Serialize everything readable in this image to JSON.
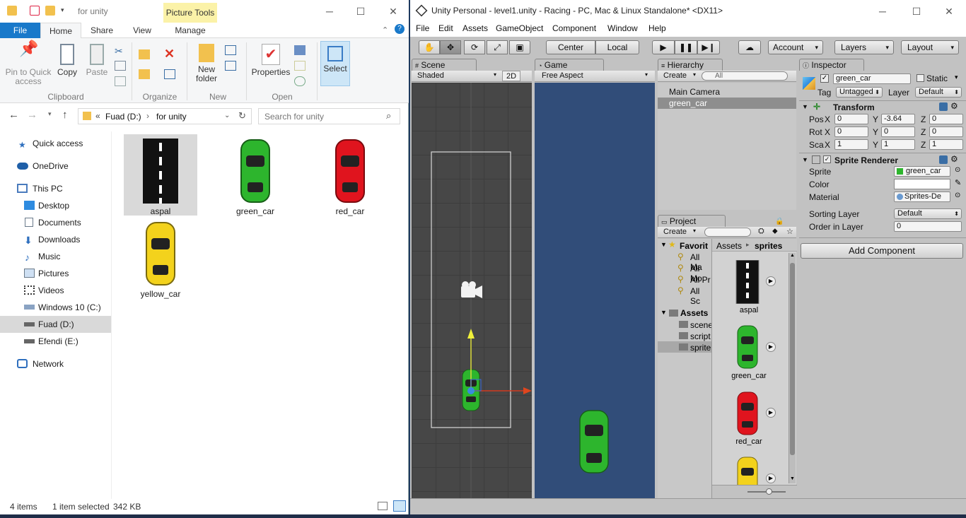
{
  "explorer": {
    "title": "for unity",
    "picture_tools": "Picture Tools",
    "tabs": [
      "File",
      "Home",
      "Share",
      "View",
      "Manage"
    ],
    "ribbon": {
      "pin": "Pin to Quick access",
      "copy": "Copy",
      "paste": "Paste",
      "new_folder": "New folder",
      "properties": "Properties",
      "select": "Select",
      "groups": [
        "Clipboard",
        "Organize",
        "New",
        "Open"
      ]
    },
    "address": {
      "root": "Fuad (D:)",
      "folder": "for unity",
      "prefix": "«"
    },
    "search_placeholder": "Search for unity",
    "nav": [
      "Quick access",
      "OneDrive",
      "This PC",
      "Desktop",
      "Documents",
      "Downloads",
      "Music",
      "Pictures",
      "Videos",
      "Windows 10 (C:)",
      "Fuad (D:)",
      "Efendi (E:)",
      "Network"
    ],
    "files": [
      "aspal",
      "green_car",
      "red_car",
      "yellow_car"
    ],
    "status": {
      "count": "4 items",
      "selected": "1 item selected",
      "size": "342 KB"
    }
  },
  "unity": {
    "title": "Unity Personal - level1.unity - Racing - PC, Mac & Linux Standalone* <DX11>",
    "menu": [
      "File",
      "Edit",
      "Assets",
      "GameObject",
      "Component",
      "Window",
      "Help"
    ],
    "toolbar": {
      "center": "Center",
      "local": "Local",
      "account": "Account",
      "layers": "Layers",
      "layout": "Layout"
    },
    "tabs": {
      "scene": "Scene",
      "game": "Game",
      "hierarchy": "Hierarchy",
      "inspector": "Inspector",
      "project": "Project"
    },
    "scene": {
      "shaded": "Shaded",
      "mode_2d": "2D"
    },
    "game": {
      "aspect": "Free Aspect"
    },
    "hierarchy": {
      "create": "Create",
      "search": "All",
      "items": [
        "Main Camera",
        "green_car"
      ]
    },
    "project": {
      "create": "Create",
      "tree": [
        "Favorit",
        "All Ma",
        "All Mo",
        "All Pr",
        "All Sc",
        "Assets",
        "scene",
        "script",
        "sprite"
      ],
      "breadcrumb": [
        "Assets",
        "sprites"
      ],
      "assets": [
        "aspal",
        "green_car",
        "red_car"
      ]
    },
    "inspector": {
      "name": "green_car",
      "static": "Static",
      "tag_label": "Tag",
      "tag": "Untagged",
      "layer_label": "Layer",
      "layer": "Default",
      "transform": "Transform",
      "pos": {
        "label": "Pos",
        "x": "0",
        "y": "-3.64",
        "z": "0"
      },
      "rot": {
        "label": "Rot",
        "x": "0",
        "y": "0",
        "z": "0"
      },
      "scale": {
        "label": "Sca",
        "x": "1",
        "y": "1",
        "z": "1"
      },
      "sprite_renderer": "Sprite Renderer",
      "sprite_label": "Sprite",
      "sprite": "green_car",
      "color_label": "Color",
      "material_label": "Material",
      "material": "Sprites-De",
      "sorting_label": "Sorting Layer",
      "sorting": "Default",
      "order_label": "Order in Layer",
      "order": "0",
      "add_component": "Add Component"
    }
  },
  "colors": {
    "accent": "#1979ca",
    "selection": "#d9d9d9",
    "unity_bg": "#c2c2c2",
    "game_bg": "#314d79",
    "scene_bg": "#474747"
  }
}
